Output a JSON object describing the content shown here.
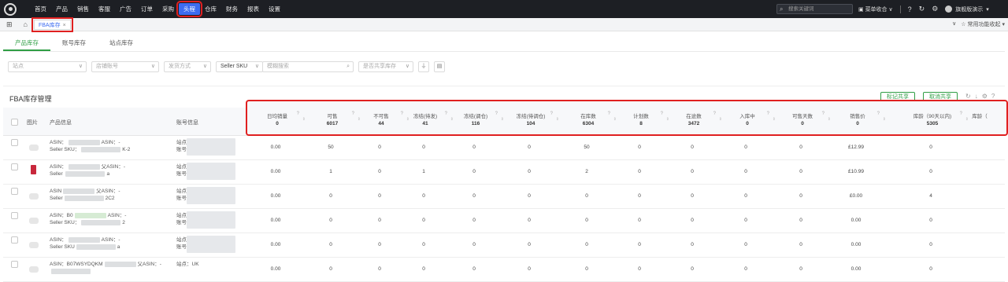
{
  "nav": {
    "items": [
      "首页",
      "产品",
      "销售",
      "客服",
      "广告",
      "订单",
      "采购",
      "头程",
      "仓库",
      "财务",
      "报表",
      "设置"
    ],
    "active_index": 7,
    "search_placeholder": "搜索关键词",
    "switch_label": "菜单收合",
    "user_name": "旗舰版演示"
  },
  "tabbar": {
    "page_tab": "FBA库存",
    "right_label": "常用功能收起"
  },
  "subtabs": [
    "产品库存",
    "账号库存",
    "站点库存"
  ],
  "subtab_active": 0,
  "filters": {
    "site": "站点",
    "account": "店铺账号",
    "ship_method": "发货方式",
    "sku_type": "Seller SKU",
    "fuzzy_search": "模糊搜索",
    "shared_stock": "是否共享库存"
  },
  "section": {
    "title": "FBA库存管理",
    "mark_shared": "标记共享",
    "unmark_shared": "取消共享"
  },
  "left_headers": {
    "image": "图片",
    "product": "产品信息",
    "account": "账号信息"
  },
  "columns": [
    {
      "label": "日均销量",
      "total": "0"
    },
    {
      "label": "可售",
      "total": "6017"
    },
    {
      "label": "不可售",
      "total": "44"
    },
    {
      "label": "冻结(待发)",
      "total": "41"
    },
    {
      "label": "冻结(调仓)",
      "total": "116"
    },
    {
      "label": "冻结(待调仓)",
      "total": "104"
    },
    {
      "label": "在库数",
      "total": "6304"
    },
    {
      "label": "计划数",
      "total": "8"
    },
    {
      "label": "在途数",
      "total": "3472"
    },
    {
      "label": "入库中",
      "total": "0"
    },
    {
      "label": "可售天数",
      "total": "0"
    },
    {
      "label": "销售价",
      "total": "0"
    },
    {
      "label": "库龄（90天以内)",
      "total": "5305"
    },
    {
      "label": "库龄（",
      "total": ""
    }
  ],
  "rows": [
    {
      "line1": "ASIN：",
      "line1b": "ASIN：-",
      "line2": "Seller SKU：",
      "line2b": "K-2",
      "acct1": "站点",
      "acct2": "账号",
      "values": [
        "0.00",
        "50",
        "0",
        "0",
        "0",
        "0",
        "50",
        "0",
        "0",
        "0",
        "0",
        "£12.99",
        "0"
      ],
      "thumb": "plain"
    },
    {
      "line1": "ASIN：",
      "line1b": "父ASIN：-",
      "line2": "Seller ",
      "line2b": "a",
      "acct1": "站点",
      "acct2": "账号",
      "values": [
        "0.00",
        "1",
        "0",
        "1",
        "0",
        "0",
        "2",
        "0",
        "0",
        "0",
        "0",
        "£10.99",
        "0"
      ],
      "thumb": "red"
    },
    {
      "line1": "ASIN",
      "line1b": "父ASIN：-",
      "line2": "Seller",
      "line2b": "2C2",
      "acct1": "站点",
      "acct2": "账号",
      "values": [
        "0.00",
        "0",
        "0",
        "0",
        "0",
        "0",
        "0",
        "0",
        "0",
        "0",
        "0",
        "£0.00",
        "4"
      ],
      "thumb": "plain"
    },
    {
      "line1": "ASIN：B0",
      "line1b": "ASIN：-",
      "line2": "Seller SKU：",
      "line2b": "2",
      "acct1": "站点",
      "acct2": "账号",
      "values": [
        "0.00",
        "0",
        "0",
        "0",
        "0",
        "0",
        "0",
        "0",
        "0",
        "0",
        "0",
        "0.00",
        "0"
      ],
      "thumb": "plain"
    },
    {
      "line1": "ASIN：",
      "line1b": "ASIN：-",
      "line2": "Seller SKU",
      "line2b": "a",
      "acct1": "站点",
      "acct2": "账号",
      "values": [
        "0.00",
        "0",
        "0",
        "0",
        "0",
        "0",
        "0",
        "0",
        "0",
        "0",
        "0",
        "0.00",
        "0"
      ],
      "thumb": "plain"
    },
    {
      "line1": "ASIN：B07WSYDQKM",
      "line1b": "父ASIN：-",
      "line2": "",
      "line2b": "",
      "acct1": "站点：UK",
      "acct2": "",
      "values": [
        "0.00",
        "0",
        "0",
        "0",
        "0",
        "0",
        "0",
        "0",
        "0",
        "0",
        "0",
        "0.00",
        "0"
      ],
      "thumb": "plain"
    }
  ]
}
